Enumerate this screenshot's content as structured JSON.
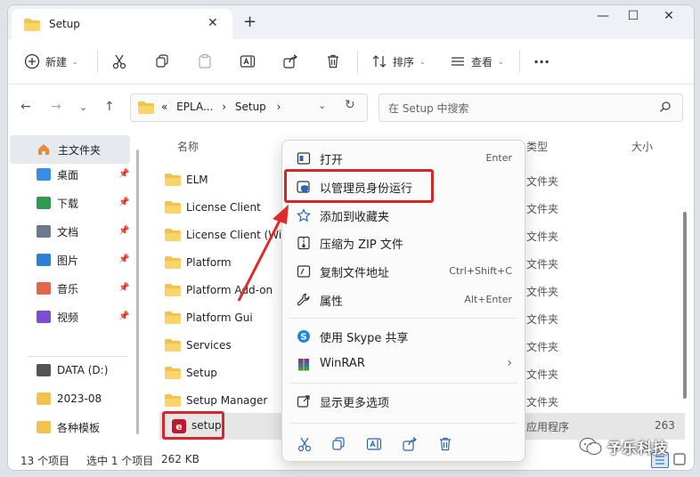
{
  "window": {
    "tab_title": "Setup",
    "colors": {
      "accent": "#0067c0",
      "folder": "#f3c44d",
      "highlight": "#d6262b",
      "eplan_red": "#c0172f"
    }
  },
  "toolbar": {
    "new_label": "新建",
    "sort_label": "排序",
    "view_label": "查看",
    "more_label": "···"
  },
  "address": {
    "path_prefix": "«",
    "path_parent": "EPLA...",
    "path_current": "Setup",
    "search_placeholder": "在 Setup 中搜索"
  },
  "sidebar": {
    "home_label": "主文件夹",
    "items": [
      {
        "label": "桌面",
        "icon": "desktop-icon",
        "color": "#3a8ee6",
        "pinned": true
      },
      {
        "label": "下载",
        "icon": "download-icon",
        "color": "#2e9b4f",
        "pinned": true
      },
      {
        "label": "文档",
        "icon": "document-icon",
        "color": "#6b7b8c",
        "pinned": true
      },
      {
        "label": "图片",
        "icon": "pictures-icon",
        "color": "#2f7fd6",
        "pinned": true
      },
      {
        "label": "音乐",
        "icon": "music-icon",
        "color": "#e0664c",
        "pinned": true
      },
      {
        "label": "视频",
        "icon": "video-icon",
        "color": "#7a4fd1",
        "pinned": true
      },
      {
        "label": "DATA (D:)",
        "icon": "drive-icon",
        "color": "#555555",
        "pinned": false
      },
      {
        "label": "2023-08",
        "icon": "folder-icon",
        "color": "#f3c44d",
        "pinned": false
      },
      {
        "label": "各种模板",
        "icon": "folder-icon",
        "color": "#f3c44d",
        "pinned": false
      }
    ]
  },
  "filelist": {
    "col_name": "名称",
    "col_type": "类型",
    "col_size": "大小",
    "rows": [
      {
        "name": "ELM",
        "type": "文件夹"
      },
      {
        "name": "License Client",
        "type": "文件夹"
      },
      {
        "name": "License Client (Wi",
        "type": "文件夹"
      },
      {
        "name": "Platform",
        "type": "文件夹"
      },
      {
        "name": "Platform Add-on",
        "type": "文件夹"
      },
      {
        "name": "Platform Gui",
        "type": "文件夹"
      },
      {
        "name": "Services",
        "type": "文件夹"
      },
      {
        "name": "Setup",
        "type": "文件夹"
      },
      {
        "name": "Setup Manager",
        "type": "文件夹"
      }
    ],
    "selected": {
      "name": "setup",
      "type": "应用程序",
      "size": "263"
    }
  },
  "context_menu": {
    "items": [
      {
        "label": "打开",
        "shortcut": "Enter",
        "icon": "open-icon"
      },
      {
        "label": "以管理员身份运行",
        "shortcut": "",
        "icon": "shield-icon"
      },
      {
        "label": "添加到收藏夹",
        "shortcut": "",
        "icon": "star-icon"
      },
      {
        "label": "压缩为 ZIP 文件",
        "shortcut": "",
        "icon": "zip-icon"
      },
      {
        "label": "复制文件地址",
        "shortcut": "Ctrl+Shift+C",
        "icon": "copy-path-icon"
      },
      {
        "label": "属性",
        "shortcut": "Alt+Enter",
        "icon": "wrench-icon"
      },
      {
        "label": "使用 Skype 共享",
        "shortcut": "",
        "icon": "skype-icon"
      },
      {
        "label": "WinRAR",
        "shortcut": "",
        "icon": "winrar-icon"
      },
      {
        "label": "显示更多选项",
        "shortcut": "",
        "icon": "more-options-icon"
      }
    ]
  },
  "status": {
    "count": "13 个项目",
    "selected": "选中 1 个项目",
    "size": "262 KB"
  },
  "watermark": {
    "text": "予乐科技"
  }
}
